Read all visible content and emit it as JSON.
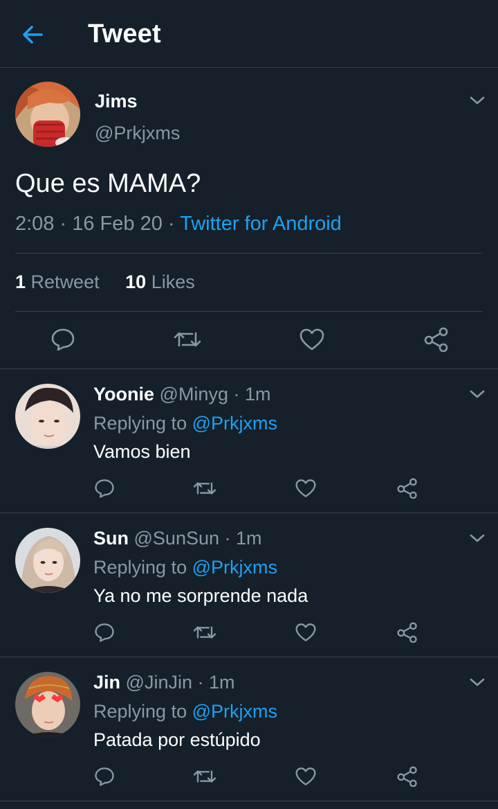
{
  "header": {
    "title": "Tweet"
  },
  "colors": {
    "background": "#15202b",
    "accent": "#1da1f2",
    "muted": "#8899a6",
    "divider": "#38444d"
  },
  "main_tweet": {
    "name": "Jims",
    "handle": "@Prkjxms",
    "text": "Que es MAMA?",
    "time": "2:08",
    "separator": " · ",
    "date": "16 Feb 20",
    "source": "Twitter for Android",
    "retweets_count": "1",
    "retweets_label": "Retweet",
    "likes_count": "10",
    "likes_label": "Likes"
  },
  "replying_prefix": "Replying to",
  "replies": [
    {
      "name": "Yoonie",
      "handle": "@Minyg",
      "time": "1m",
      "mention": "@Prkjxms",
      "text": "Vamos bien"
    },
    {
      "name": "Sun",
      "handle": "@SunSun",
      "time": "1m",
      "mention": "@Prkjxms",
      "text": "Ya no me sorprende nada"
    },
    {
      "name": "Jin",
      "handle": "@JinJin",
      "time": "1m",
      "mention": "@Prkjxms",
      "text": "Patada por estúpido"
    }
  ],
  "icons": [
    "back-arrow-icon",
    "chevron-down-icon",
    "reply-icon",
    "retweet-icon",
    "like-icon",
    "share-icon"
  ]
}
